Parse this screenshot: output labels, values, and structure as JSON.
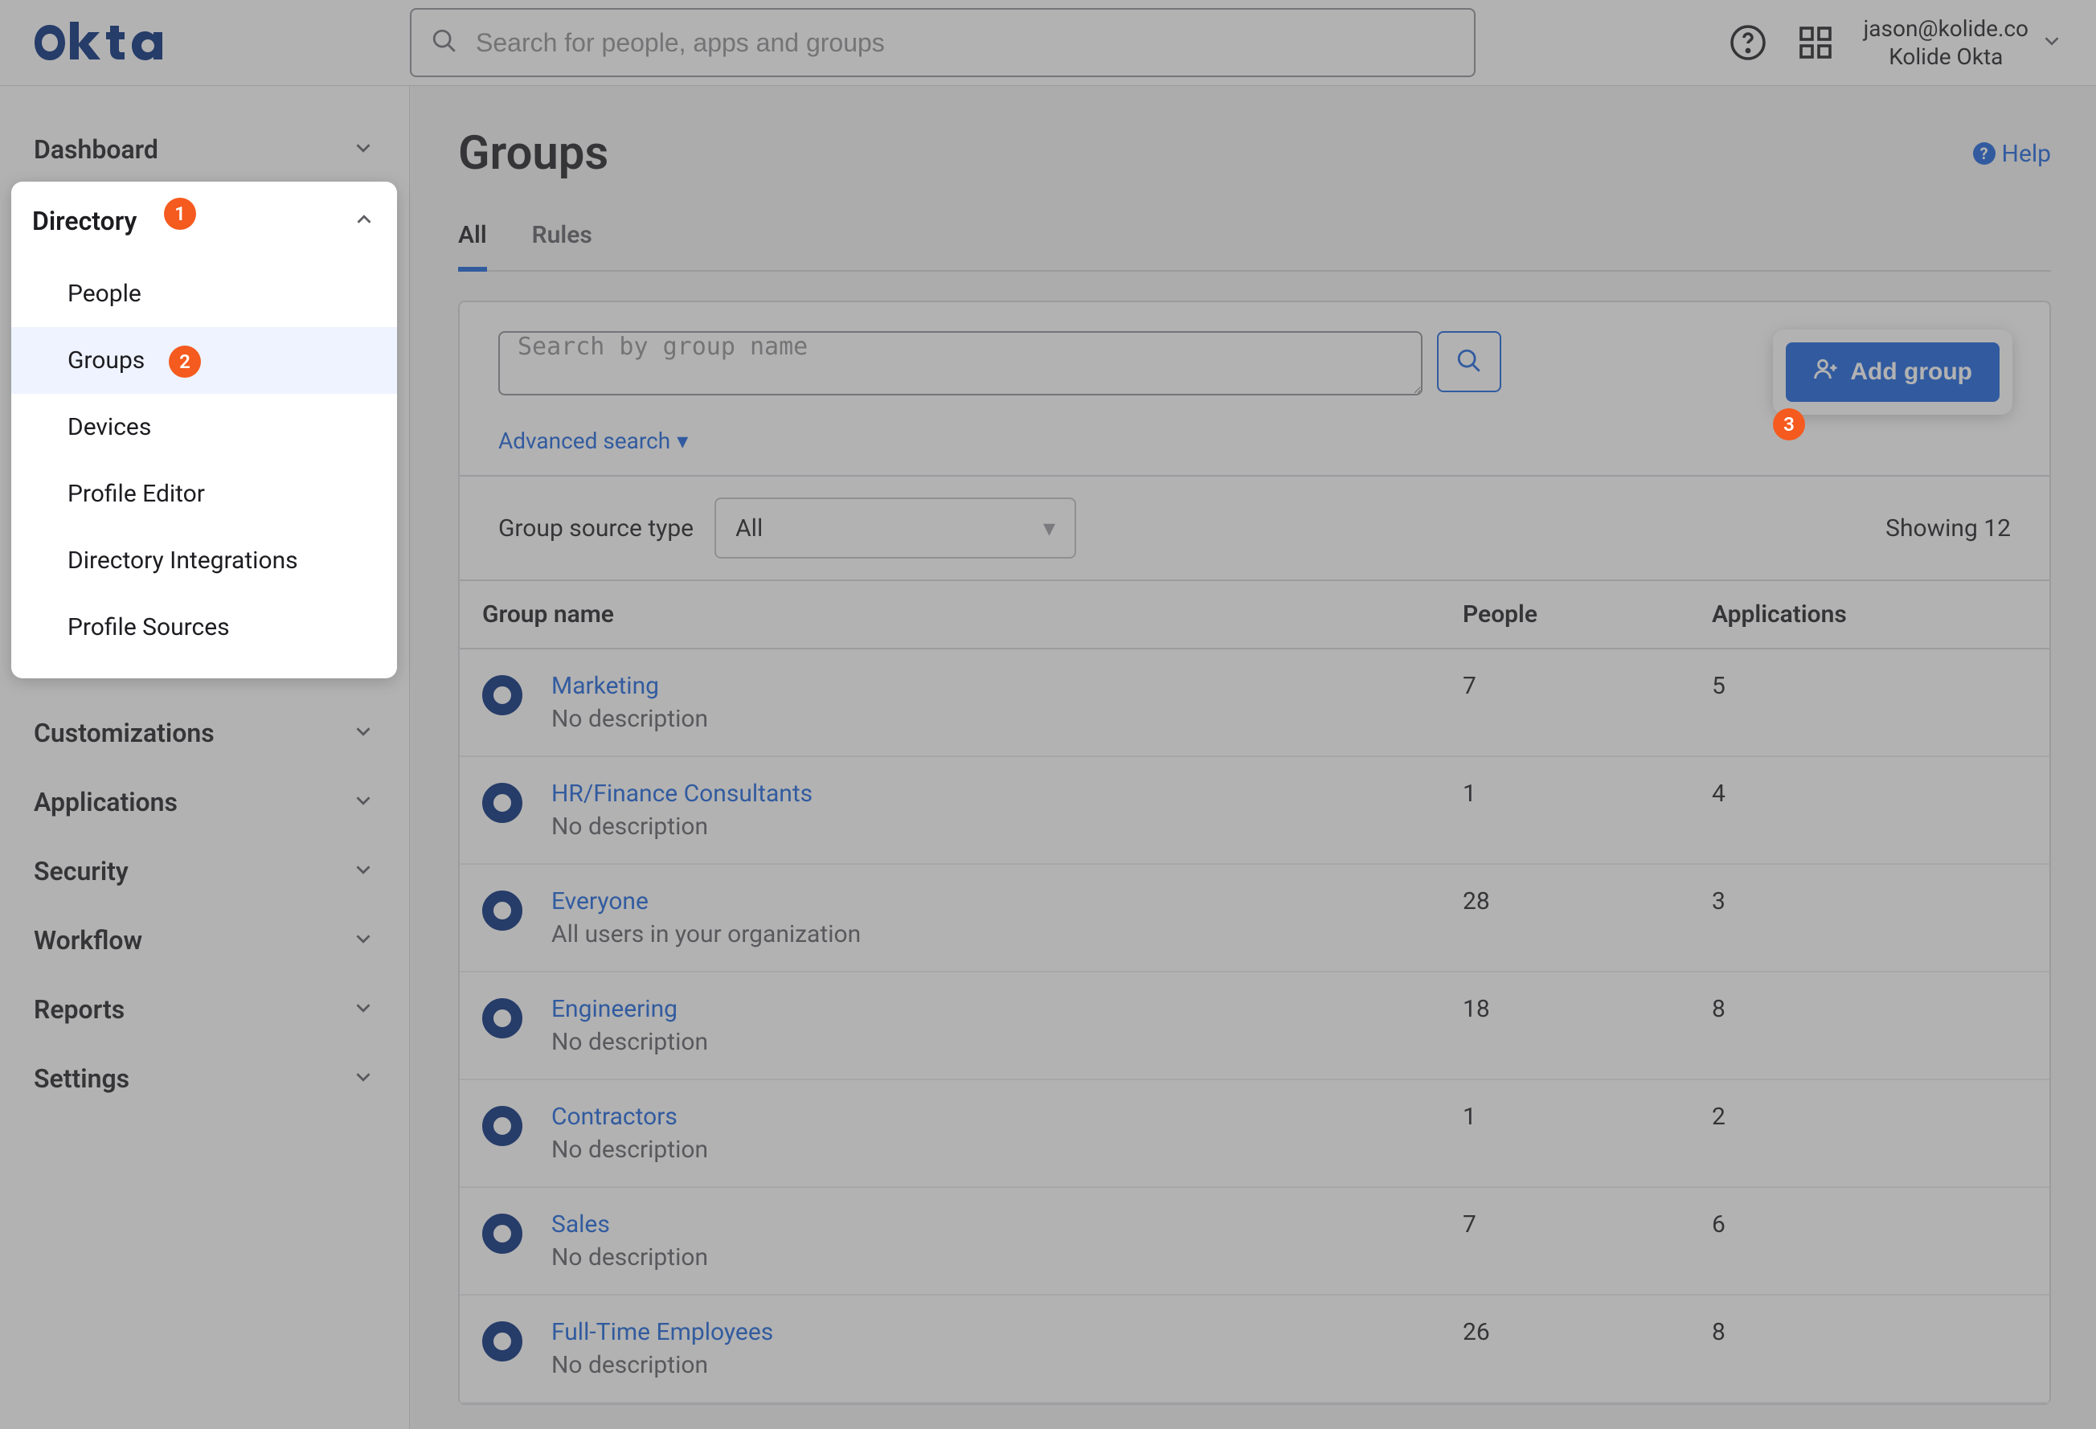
{
  "header": {
    "logo_text": "okta",
    "search_placeholder": "Search for people, apps and groups",
    "user_email": "jason@kolide.co",
    "user_org": "Kolide Okta"
  },
  "sidebar": {
    "items": [
      {
        "label": "Dashboard"
      },
      {
        "label": "Directory"
      },
      {
        "label": "Customizations"
      },
      {
        "label": "Applications"
      },
      {
        "label": "Security"
      },
      {
        "label": "Workflow"
      },
      {
        "label": "Reports"
      },
      {
        "label": "Settings"
      }
    ],
    "directory_sub": [
      {
        "label": "People"
      },
      {
        "label": "Groups"
      },
      {
        "label": "Devices"
      },
      {
        "label": "Profile Editor"
      },
      {
        "label": "Directory Integrations"
      },
      {
        "label": "Profile Sources"
      }
    ]
  },
  "callouts": {
    "one": "1",
    "two": "2",
    "three": "3"
  },
  "page": {
    "title": "Groups",
    "help_label": "Help",
    "tabs": {
      "all": "All",
      "rules": "Rules"
    },
    "search_placeholder": "Search by group name",
    "advanced_search": "Advanced search",
    "add_group_label": "Add group",
    "group_source_type_label": "Group source type",
    "group_source_type_value": "All",
    "showing_prefix": "Showing ",
    "showing_count": "12",
    "columns": {
      "name": "Group name",
      "people": "People",
      "apps": "Applications"
    },
    "rows": [
      {
        "name": "Marketing",
        "desc": "No description",
        "people": "7",
        "apps": "5"
      },
      {
        "name": "HR/Finance Consultants",
        "desc": "No description",
        "people": "1",
        "apps": "4"
      },
      {
        "name": "Everyone",
        "desc": "All users in your organization",
        "people": "28",
        "apps": "3"
      },
      {
        "name": "Engineering",
        "desc": "No description",
        "people": "18",
        "apps": "8"
      },
      {
        "name": "Contractors",
        "desc": "No description",
        "people": "1",
        "apps": "2"
      },
      {
        "name": "Sales",
        "desc": "No description",
        "people": "7",
        "apps": "6"
      },
      {
        "name": "Full-Time Employees",
        "desc": "No description",
        "people": "26",
        "apps": "8"
      }
    ]
  }
}
